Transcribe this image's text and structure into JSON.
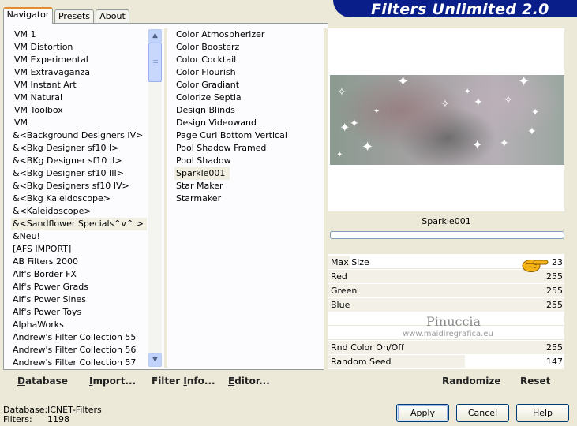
{
  "app": {
    "title": "Filters Unlimited 2.0"
  },
  "tabs": [
    {
      "label": "Navigator"
    },
    {
      "label": "Presets"
    },
    {
      "label": "About"
    }
  ],
  "categories": [
    "VM 1",
    "VM Distortion",
    "VM Experimental",
    "VM Extravaganza",
    "VM Instant Art",
    "VM Natural",
    "VM Toolbox",
    "VM",
    "&<Background Designers IV>",
    "&<Bkg Designer sf10 I>",
    "&<BKg Designer sf10 II>",
    "&<Bkg Designer sf10 III>",
    "&<Bkg Designers sf10 IV>",
    "&<Bkg Kaleidoscope>",
    "&<Kaleidoscope>",
    "&<Sandflower Specials^v^ >",
    "&Neu!",
    "[AFS IMPORT]",
    "AB Filters 2000",
    "Alf's Border FX",
    "Alf's Power Grads",
    "Alf's Power Sines",
    "Alf's Power Toys",
    "AlphaWorks",
    "Andrew's Filter Collection 55",
    "Andrew's Filter Collection 56",
    "Andrew's Filter Collection 57"
  ],
  "selected_category": "&<Sandflower Specials^v^ >",
  "filters": [
    "Color Atmospherizer",
    "Color Boosterz",
    "Color Cocktail",
    "Color Flourish",
    "Color Gradiant",
    "Colorize Septia",
    "Design Blinds",
    "Design Videowand",
    "Page Curl Bottom Vertical",
    "Pool Shadow Framed",
    "Pool Shadow",
    "Sparkle001",
    "Star Maker",
    "Starmaker"
  ],
  "selected_filter": "Sparkle001",
  "preview": {
    "filter_name": "Sparkle001"
  },
  "params": [
    {
      "label": "Max Size",
      "value": "23",
      "fraction": 0.09
    },
    {
      "label": "Red",
      "value": "255",
      "fraction": 1.0
    },
    {
      "label": "Green",
      "value": "255",
      "fraction": 1.0
    },
    {
      "label": "Blue",
      "value": "255",
      "fraction": 1.0
    },
    {
      "label": "",
      "value": ""
    },
    {
      "label": "",
      "value": ""
    },
    {
      "label": "Rnd Color On/Off",
      "value": "255",
      "fraction": 1.0
    },
    {
      "label": "Random Seed",
      "value": "147",
      "fraction": 0.58
    }
  ],
  "watermark": {
    "line1": "Pinuccia",
    "line2": "www.maidiregrafica.eu"
  },
  "left_links": {
    "database": {
      "pre": "",
      "u": "D",
      "post": "atabase"
    },
    "import": {
      "pre": "",
      "u": "I",
      "post": "mport..."
    },
    "filter_info": {
      "pre": "Filter ",
      "u": "I",
      "post": "nfo..."
    },
    "editor": {
      "pre": "",
      "u": "E",
      "post": "ditor..."
    }
  },
  "right_links": {
    "randomize": "Randomize",
    "reset": "Reset"
  },
  "status": {
    "database_label": "Database:",
    "database_value": "ICNET-Filters",
    "filters_label": "Filters:",
    "filters_value": "1198"
  },
  "buttons": {
    "apply": "Apply",
    "cancel": "Cancel",
    "help": "Help"
  },
  "colors": {
    "banner": "#0a1e8a",
    "tab_accent": "#e68b2c",
    "slider_fill": "#f3f1e7"
  }
}
